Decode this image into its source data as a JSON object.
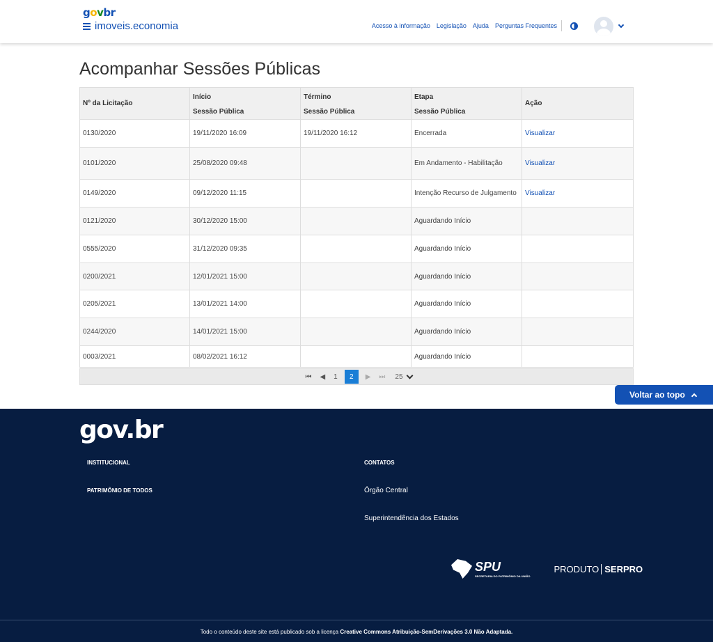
{
  "header": {
    "logo": {
      "g": "g",
      "o": "o",
      "v": "v",
      "b": "br"
    },
    "site_name": "imoveis.economia",
    "links": [
      "Acesso à informação",
      "Legislação",
      "Ajuda",
      "Perguntas Frequentes"
    ]
  },
  "page_title": "Acompanhar Sessões Públicas",
  "table": {
    "headers": [
      {
        "l1": "Nº da Licitação",
        "l2": ""
      },
      {
        "l1": "Início",
        "l2": "Sessão Pública"
      },
      {
        "l1": "Término",
        "l2": "Sessão Pública"
      },
      {
        "l1": "Etapa",
        "l2": "Sessão Pública"
      },
      {
        "l1": "Ação",
        "l2": ""
      }
    ],
    "rows": [
      {
        "num": "0130/2020",
        "inicio": "19/11/2020 16:09",
        "termino": "19/11/2020 16:12",
        "etapa": "Encerrada",
        "acao": "Visualizar"
      },
      {
        "num": "0101/2020",
        "inicio": "25/08/2020 09:48",
        "termino": "",
        "etapa": "Em Andamento - Habilitação",
        "acao": "Visualizar"
      },
      {
        "num": "0149/2020",
        "inicio": "09/12/2020 11:15",
        "termino": "",
        "etapa": "Intenção Recurso de Julgamento",
        "acao": "Visualizar"
      },
      {
        "num": "0121/2020",
        "inicio": "30/12/2020 15:00",
        "termino": "",
        "etapa": "Aguardando Início",
        "acao": ""
      },
      {
        "num": "0555/2020",
        "inicio": "31/12/2020 09:35",
        "termino": "",
        "etapa": "Aguardando Início",
        "acao": ""
      },
      {
        "num": "0200/2021",
        "inicio": "12/01/2021 15:00",
        "termino": "",
        "etapa": "Aguardando Início",
        "acao": ""
      },
      {
        "num": "0205/2021",
        "inicio": "13/01/2021 14:00",
        "termino": "",
        "etapa": "Aguardando Início",
        "acao": ""
      },
      {
        "num": "0244/2020",
        "inicio": "14/01/2021 15:00",
        "termino": "",
        "etapa": "Aguardando Início",
        "acao": ""
      },
      {
        "num": "0003/2021",
        "inicio": "08/02/2021 16:12",
        "termino": "",
        "etapa": "Aguardando Início",
        "acao": ""
      }
    ]
  },
  "pager": {
    "first": "⏮",
    "prev": "◀",
    "page1": "1",
    "current": "2",
    "next": "▶",
    "last": "⏭",
    "page_size": "25"
  },
  "back_to_top": "Voltar ao topo",
  "footer": {
    "logo": "gov.br",
    "col1": [
      "INSTITUCIONAL",
      "PATRIMÔNIO DE TODOS"
    ],
    "col2_title": "CONTATOS",
    "col2_links": [
      "Órgão Central",
      "Superintendência dos Estados"
    ],
    "spu": "SPU",
    "spu_sub": "SECRETARIA DO PATRIMÔNIO DA UNIÃO",
    "produto": "PRODUTO",
    "serpro": "SERPRO",
    "license_text": "Todo o conteúdo deste site está publicado sob a licença",
    "license_bold": "Creative Commons Atribuição-SemDerivações 3.0 Não Adaptada."
  }
}
